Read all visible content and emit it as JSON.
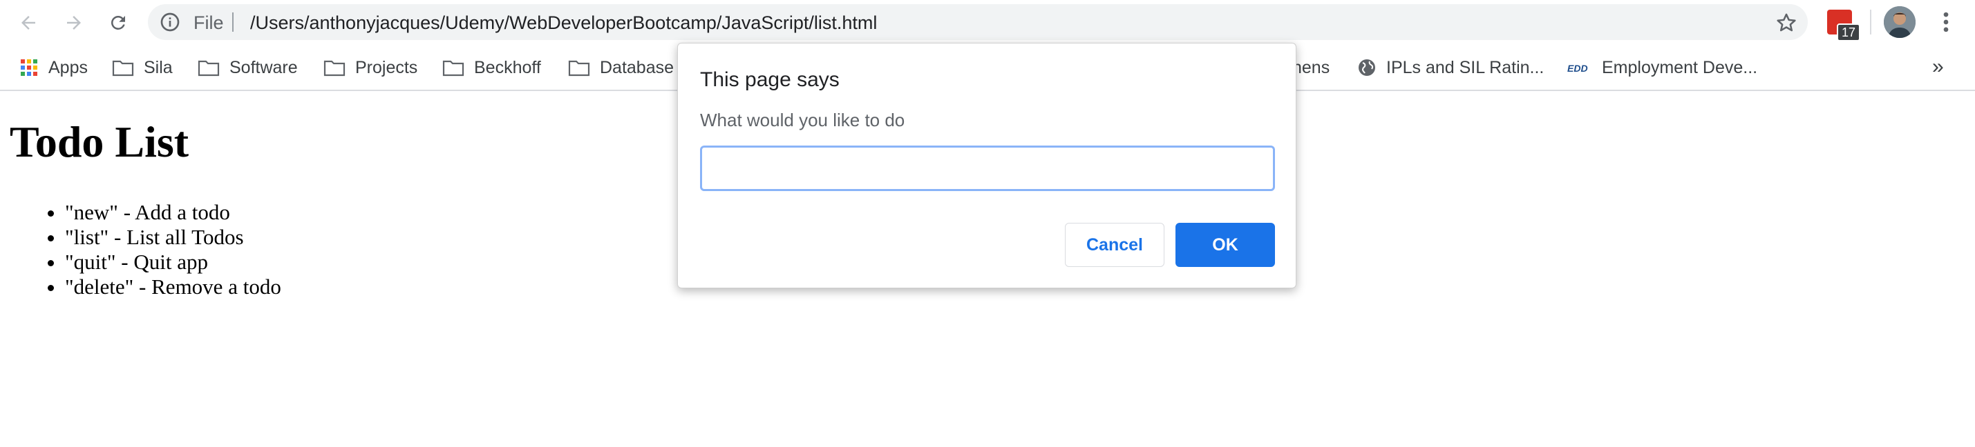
{
  "browser": {
    "omnibox": {
      "scheme": "File",
      "url": "/Users/anthonyjacques/Udemy/WebDeveloperBootcamp/JavaScript/list.html"
    },
    "extension_badge": "17",
    "bookmarks": [
      {
        "label": "Apps",
        "icon": "apps-grid-icon"
      },
      {
        "label": "Sila",
        "icon": "folder-icon"
      },
      {
        "label": "Software",
        "icon": "folder-icon"
      },
      {
        "label": "Projects",
        "icon": "folder-icon"
      },
      {
        "label": "Beckhoff",
        "icon": "folder-icon"
      },
      {
        "label": "Database",
        "icon": "folder-icon"
      },
      {
        "label": "nens",
        "icon": ""
      },
      {
        "label": "IPLs and SIL Ratin...",
        "icon": "globe-icon"
      },
      {
        "label": "Employment Deve...",
        "icon": "edd-logo-icon"
      }
    ],
    "more_bookmarks": "»"
  },
  "page": {
    "title": "Todo List",
    "items": [
      "\"new\" - Add a todo",
      "\"list\" - List all Todos",
      "\"quit\" - Quit app",
      "\"delete\" - Remove a todo"
    ]
  },
  "dialog": {
    "title": "This page says",
    "message": "What would you like to do",
    "input_value": "",
    "cancel_label": "Cancel",
    "ok_label": "OK"
  },
  "colors": {
    "accent": "#1a73e8",
    "focus_ring": "#8ab4f8",
    "omnibox_bg": "#f1f3f4"
  }
}
